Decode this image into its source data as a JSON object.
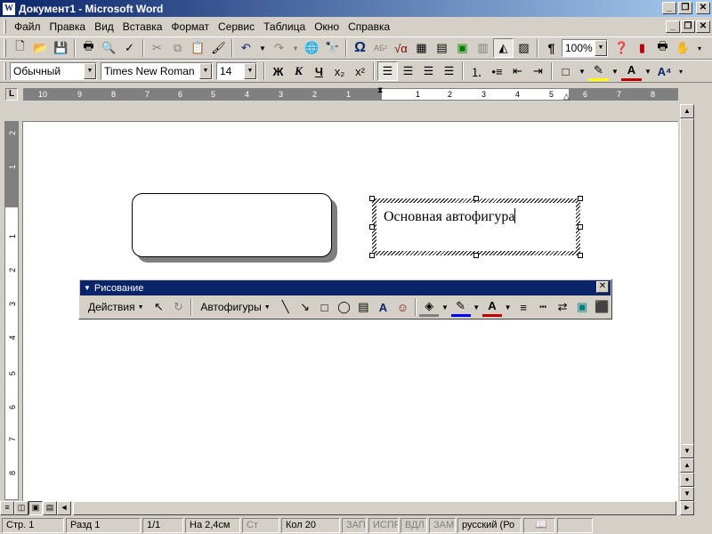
{
  "window": {
    "title": "Документ1 - Microsoft Word",
    "icon": "W"
  },
  "menu": [
    "Файл",
    "Правка",
    "Вид",
    "Вставка",
    "Формат",
    "Сервис",
    "Таблица",
    "Окно",
    "Справка"
  ],
  "standard_toolbar": {
    "zoom": "100%"
  },
  "formatting_toolbar": {
    "style": "Обычный",
    "font": "Times New Roman",
    "size": "14"
  },
  "format_buttons": {
    "bold": "Ж",
    "italic": "К",
    "underline": "Ч"
  },
  "ruler": {
    "left_marks": [
      "10",
      "9",
      "8",
      "7",
      "6",
      "5",
      "4",
      "3",
      "2",
      "1"
    ],
    "right_marks": [
      "1",
      "2",
      "3",
      "4",
      "5",
      "6",
      "7",
      "8"
    ],
    "corner": "L"
  },
  "vruler_marks": [
    "2",
    "1",
    "1",
    "2",
    "3",
    "4",
    "5",
    "6",
    "7",
    "8",
    "9"
  ],
  "document": {
    "autoshape_text": "Основная автофигура"
  },
  "drawing_toolbar": {
    "title": "Рисование",
    "actions": "Действия",
    "autoshapes": "Автофигуры"
  },
  "status": {
    "page": "Стр. 1",
    "section": "Разд 1",
    "pages": "1/1",
    "position": "На 2,4см",
    "line": "Ст",
    "column": "Кол 20",
    "rec": "ЗАП",
    "trk": "ИСПР",
    "ext": "ВДЛ",
    "ovr": "ЗАМ",
    "language": "русский (Ро"
  }
}
